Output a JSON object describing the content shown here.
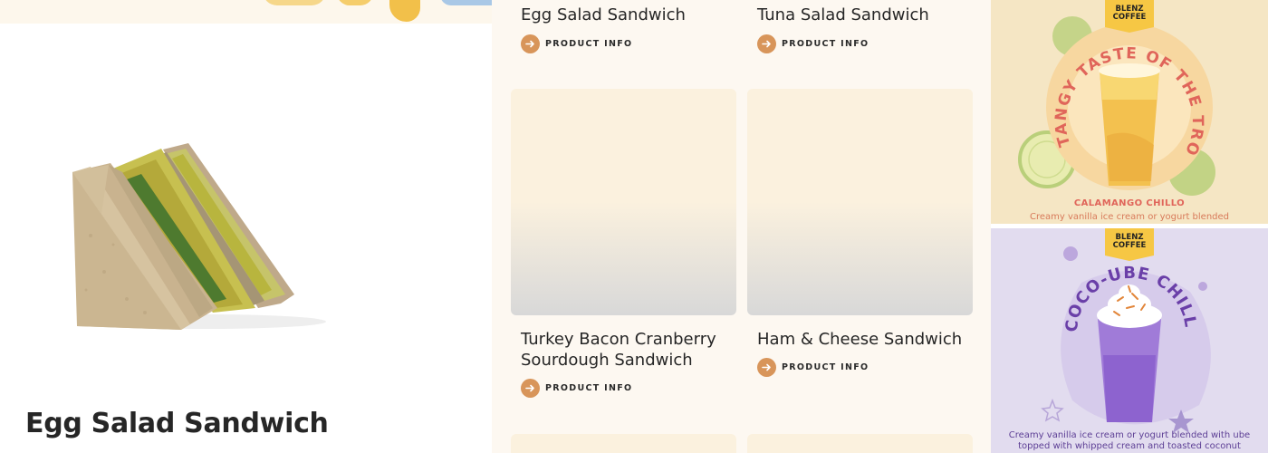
{
  "detail": {
    "product_title": "Egg Salad Sandwich",
    "image_icon": "egg-salad-sandwich-image"
  },
  "grid": {
    "info_label": "PRODUCT INFO",
    "arrow_icon": "arrow-right-icon",
    "accent_color": "#d8955a",
    "items": [
      {
        "name": "Egg Salad Sandwich"
      },
      {
        "name": "Tuna Salad Sandwich"
      },
      {
        "name": "Turkey Bacon Cranberry Sourdough Sandwich"
      },
      {
        "name": "Ham & Cheese Sandwich"
      }
    ]
  },
  "promos": [
    {
      "brand_line1": "BLENZ",
      "brand_line2": "COFFEE",
      "headline": "TANGY TASTE OF THE TROPICS",
      "name": "CALAMANGO CHILLO",
      "description": "Creamy vanilla ice cream or yogurt blended",
      "color": "#e0655a"
    },
    {
      "brand_line1": "BLENZ",
      "brand_line2": "COFFEE",
      "headline": "COCO-UBE CHILLO",
      "description_line1": "Creamy vanilla ice cream or yogurt blended with ube",
      "description_line2": "topped with whipped cream and toasted coconut",
      "color": "#6a3fa8"
    }
  ]
}
